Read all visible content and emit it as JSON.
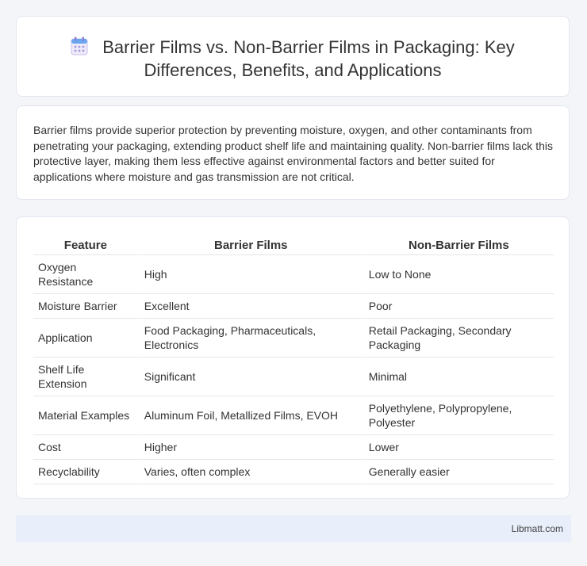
{
  "header": {
    "title": "Barrier Films vs. Non-Barrier Films in Packaging: Key Differences, Benefits, and Applications",
    "icon": "calendar-icon"
  },
  "intro": {
    "text": "Barrier films provide superior protection by preventing moisture, oxygen, and other contaminants from penetrating your packaging, extending product shelf life and maintaining quality. Non-barrier films lack this protective layer, making them less effective against environmental factors and better suited for applications where moisture and gas transmission are not critical."
  },
  "table": {
    "headers": [
      "Feature",
      "Barrier Films",
      "Non-Barrier Films"
    ],
    "rows": [
      [
        "Oxygen Resistance",
        "High",
        "Low to None"
      ],
      [
        "Moisture Barrier",
        "Excellent",
        "Poor"
      ],
      [
        "Application",
        "Food Packaging, Pharmaceuticals, Electronics",
        "Retail Packaging, Secondary Packaging"
      ],
      [
        "Shelf Life Extension",
        "Significant",
        "Minimal"
      ],
      [
        "Material Examples",
        "Aluminum Foil, Metallized Films, EVOH",
        "Polyethylene, Polypropylene, Polyester"
      ],
      [
        "Cost",
        "Higher",
        "Lower"
      ],
      [
        "Recyclability",
        "Varies, often complex",
        "Generally easier"
      ]
    ]
  },
  "footer": {
    "brand": "Libmatt.com"
  },
  "colors": {
    "page_bg": "#f3f5f9",
    "footer_bg": "#e8eefa",
    "icon_accent": "#8b7fd6"
  }
}
